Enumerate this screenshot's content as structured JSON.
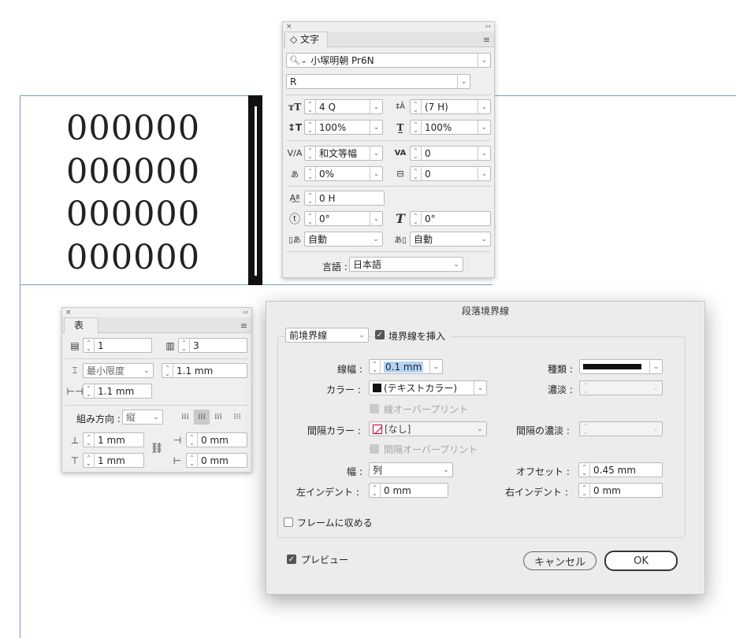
{
  "canvas": {
    "digits": [
      "000000",
      "000000",
      "000000",
      "000000"
    ]
  },
  "char_panel": {
    "close": "×",
    "collapse": "‹‹",
    "tab": "◇ 文字",
    "menu": "≡",
    "font_family": "小塚明朝 Pr6N",
    "font_style": "R",
    "font_size": "4 Q",
    "leading": "(7 H)",
    "vscale": "100%",
    "hscale": "100%",
    "tsume": "和文等幅",
    "tracking": "0",
    "tsume_pct": "0%",
    "aki": "0",
    "baseline": "0 H",
    "rotate": "0°",
    "skew": "0°",
    "aki_before": "自動",
    "aki_after": "自動",
    "lang_label": "言語 :",
    "lang": "日本語"
  },
  "table_panel": {
    "close": "×",
    "collapse": "‹‹",
    "tab": "表",
    "menu": "≡",
    "rows": "1",
    "cols": "3",
    "row_height_mode": "最小限度",
    "row_height": "1.1 mm",
    "col_width": "1.1 mm",
    "dir_label": "組み方向 :",
    "dir_value": "縦",
    "inset_top": "1 mm",
    "inset_bottom": "1 mm",
    "inset_left": "0 mm",
    "inset_right": "0 mm"
  },
  "dialog": {
    "title": "段落境界線",
    "rule_type": "前境界線",
    "insert_label": "境界線を挿入",
    "weight_label": "線幅 :",
    "weight": "0.1 mm",
    "type_label": "種類 :",
    "color_label": "カラー :",
    "color": "(テキストカラー)",
    "tint_label": "濃淡 :",
    "overprint_label": "線オーバープリント",
    "gap_color_label": "間隔カラー :",
    "gap_color": "[なし]",
    "gap_tint_label": "間隔の濃淡 :",
    "gap_overprint_label": "間隔オーバープリント",
    "width_label": "幅 :",
    "width": "列",
    "offset_label": "オフセット :",
    "offset": "0.45 mm",
    "left_indent_label": "左インデント :",
    "left_indent": "0 mm",
    "right_indent_label": "右インデント :",
    "right_indent": "0 mm",
    "fit_frame_label": "フレームに収める",
    "preview_label": "プレビュー",
    "cancel": "キャンセル",
    "ok": "OK"
  }
}
